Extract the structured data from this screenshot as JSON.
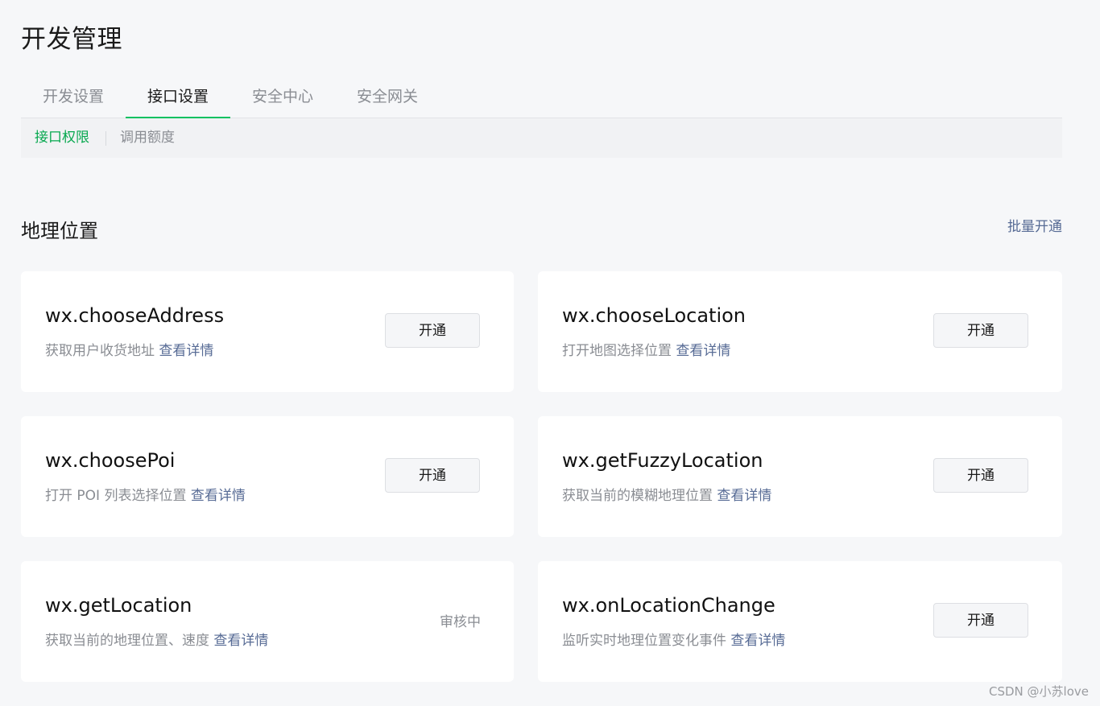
{
  "page": {
    "title": "开发管理"
  },
  "tabs": [
    {
      "label": "开发设置",
      "active": false
    },
    {
      "label": "接口设置",
      "active": true
    },
    {
      "label": "安全中心",
      "active": false
    },
    {
      "label": "安全网关",
      "active": false
    }
  ],
  "subnav": [
    {
      "label": "接口权限",
      "active": true
    },
    {
      "label": "调用额度",
      "active": false
    }
  ],
  "section": {
    "title": "地理位置",
    "batch_label": "批量开通"
  },
  "apis": [
    {
      "name": "wx.chooseAddress",
      "desc": "获取用户收货地址",
      "detail": "查看详情",
      "action": "开通"
    },
    {
      "name": "wx.chooseLocation",
      "desc": "打开地图选择位置",
      "detail": "查看详情",
      "action": "开通"
    },
    {
      "name": "wx.choosePoi",
      "desc": "打开 POI 列表选择位置",
      "detail": "查看详情",
      "action": "开通"
    },
    {
      "name": "wx.getFuzzyLocation",
      "desc": "获取当前的模糊地理位置",
      "detail": "查看详情",
      "action": "开通"
    },
    {
      "name": "wx.getLocation",
      "desc": "获取当前的地理位置、速度",
      "detail": "查看详情",
      "status": "审核中"
    },
    {
      "name": "wx.onLocationChange",
      "desc": "监听实时地理位置变化事件",
      "detail": "查看详情",
      "action": "开通"
    }
  ],
  "watermark": "CSDN @小苏love",
  "colors": {
    "accent_green": "#07c160",
    "link_blue": "#576b95",
    "background": "#f6f7f9"
  }
}
